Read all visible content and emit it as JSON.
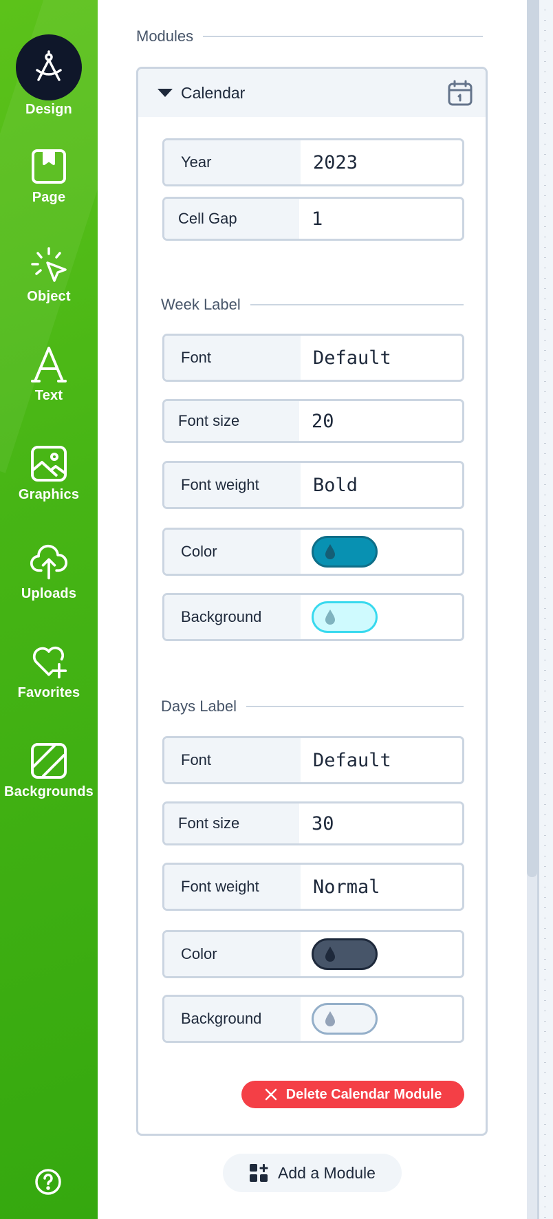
{
  "sidebar": {
    "items": [
      {
        "label": "Design",
        "icon": "compass-icon"
      },
      {
        "label": "Page",
        "icon": "bookmark-page-icon"
      },
      {
        "label": "Object",
        "icon": "cursor-click-icon"
      },
      {
        "label": "Text",
        "icon": "text-a-icon"
      },
      {
        "label": "Graphics",
        "icon": "image-icon"
      },
      {
        "label": "Uploads",
        "icon": "cloud-upload-icon"
      },
      {
        "label": "Favorites",
        "icon": "heart-plus-icon"
      },
      {
        "label": "Backgrounds",
        "icon": "background-icon"
      }
    ],
    "help_icon": "help-circle-icon"
  },
  "panel": {
    "section_title": "Modules",
    "module": {
      "title": "Calendar",
      "icon": "calendar-icon",
      "fields": [
        {
          "label": "Year",
          "value": "2023"
        },
        {
          "label": "Cell Gap",
          "value": "1"
        }
      ],
      "week_label": {
        "title": "Week Label",
        "font_label": "Font",
        "font_value": "Default",
        "size_label": "Font size",
        "size_value": "20",
        "weight_label": "Font weight",
        "weight_value": "Bold",
        "color_label": "Color",
        "color_value": "#0891b2",
        "bg_label": "Background",
        "bg_value": "#cffafe"
      },
      "days_label": {
        "title": "Days Label",
        "font_label": "Font",
        "font_value": "Default",
        "size_label": "Font size",
        "size_value": "30",
        "weight_label": "Font weight",
        "weight_value": "Normal",
        "color_label": "Color",
        "color_value": "#475569",
        "bg_label": "Background",
        "bg_value": "#f1f5f9"
      },
      "delete_label": "Delete Calendar Module"
    },
    "add_label": "Add a Module"
  },
  "colors": {
    "sidebar_green": "#47b515",
    "active_bg": "#0f172a",
    "danger": "#f43f46"
  }
}
